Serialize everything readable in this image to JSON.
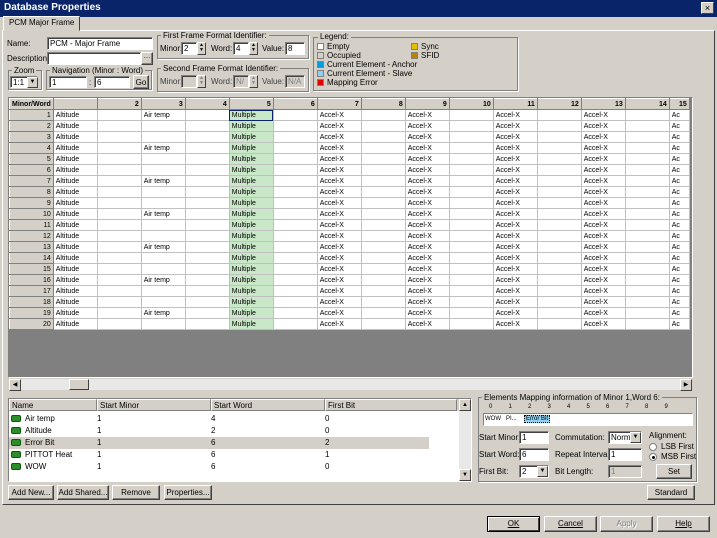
{
  "window": {
    "title": "Database Properties",
    "close_glyph": "×"
  },
  "tab": {
    "label": "PCM Major Frame"
  },
  "fields": {
    "name_label": "Name:",
    "name_value": "PCM - Major Frame",
    "description_label": "Description",
    "description_value": "",
    "zoom_label": "Zoom",
    "zoom_value": "1:1",
    "nav_label": "Navigation (Minor : Word)",
    "nav_minor": "1",
    "nav_sep": ":",
    "nav_word": "6",
    "go_label": "Go"
  },
  "first_ffi": {
    "title": "First Frame Format Identifier:",
    "minor_label": "Minor:",
    "minor_value": "2",
    "word_label": "Word:",
    "word_value": "4",
    "value_label": "Value:",
    "value_value": "8"
  },
  "second_ffi": {
    "title": "Second Frame Format Identifier:",
    "minor_label": "Minor:",
    "minor_value": "",
    "word_label": "Word:",
    "word_value": "N/",
    "value_label": "Value:",
    "value_value": "N/A"
  },
  "legend": {
    "title": "Legend:",
    "items": [
      {
        "label": "Empty",
        "color": "#ffffff"
      },
      {
        "label": "Occupied",
        "color": "#d4d0c8"
      },
      {
        "label": "Current Element - Anchor",
        "color": "#00a0e0"
      },
      {
        "label": "Current Element - Slave",
        "color": "#90d0f0"
      },
      {
        "label": "Mapping Error",
        "color": "#e00000"
      },
      {
        "label": "Sync",
        "color": "#e0c000"
      },
      {
        "label": "SFID",
        "color": "#c08000"
      }
    ]
  },
  "grid": {
    "corner": "Minor/Word",
    "columns": [
      "2",
      "3",
      "4",
      "5",
      "6",
      "7",
      "8",
      "9",
      "10",
      "11",
      "12",
      "13",
      "14",
      "15"
    ],
    "rows": [
      {
        "n": "1",
        "c": [
          "Altitude",
          "",
          "Air temp",
          "",
          "Multiple",
          "",
          "Accel-X",
          "",
          "Accel-X",
          "",
          "Accel-X",
          "",
          "Accel-X",
          "",
          "Ac"
        ]
      },
      {
        "n": "2",
        "c": [
          "Altitude",
          "",
          "",
          "",
          "Multiple",
          "",
          "Accel-X",
          "",
          "Accel-X",
          "",
          "Accel-X",
          "",
          "Accel-X",
          "",
          "Ac"
        ]
      },
      {
        "n": "3",
        "c": [
          "Altitude",
          "",
          "",
          "",
          "Multiple",
          "",
          "Accel-X",
          "",
          "Accel-X",
          "",
          "Accel-X",
          "",
          "Accel-X",
          "",
          "Ac"
        ]
      },
      {
        "n": "4",
        "c": [
          "Altitude",
          "",
          "Air temp",
          "",
          "Multiple",
          "",
          "Accel-X",
          "",
          "Accel-X",
          "",
          "Accel-X",
          "",
          "Accel-X",
          "",
          "Ac"
        ]
      },
      {
        "n": "5",
        "c": [
          "Altitude",
          "",
          "",
          "",
          "Multiple",
          "",
          "Accel-X",
          "",
          "Accel-X",
          "",
          "Accel-X",
          "",
          "Accel-X",
          "",
          "Ac"
        ]
      },
      {
        "n": "6",
        "c": [
          "Altitude",
          "",
          "",
          "",
          "Multiple",
          "",
          "Accel-X",
          "",
          "Accel-X",
          "",
          "Accel-X",
          "",
          "Accel-X",
          "",
          "Ac"
        ]
      },
      {
        "n": "7",
        "c": [
          "Altitude",
          "",
          "Air temp",
          "",
          "Multiple",
          "",
          "Accel-X",
          "",
          "Accel-X",
          "",
          "Accel-X",
          "",
          "Accel-X",
          "",
          "Ac"
        ]
      },
      {
        "n": "8",
        "c": [
          "Altitude",
          "",
          "",
          "",
          "Multiple",
          "",
          "Accel-X",
          "",
          "Accel-X",
          "",
          "Accel-X",
          "",
          "Accel-X",
          "",
          "Ac"
        ]
      },
      {
        "n": "9",
        "c": [
          "Altitude",
          "",
          "",
          "",
          "Multiple",
          "",
          "Accel-X",
          "",
          "Accel-X",
          "",
          "Accel-X",
          "",
          "Accel-X",
          "",
          "Ac"
        ]
      },
      {
        "n": "10",
        "c": [
          "Altitude",
          "",
          "Air temp",
          "",
          "Multiple",
          "",
          "Accel-X",
          "",
          "Accel-X",
          "",
          "Accel-X",
          "",
          "Accel-X",
          "",
          "Ac"
        ]
      },
      {
        "n": "11",
        "c": [
          "Altitude",
          "",
          "",
          "",
          "Multiple",
          "",
          "Accel-X",
          "",
          "Accel-X",
          "",
          "Accel-X",
          "",
          "Accel-X",
          "",
          "Ac"
        ]
      },
      {
        "n": "12",
        "c": [
          "Altitude",
          "",
          "",
          "",
          "Multiple",
          "",
          "Accel-X",
          "",
          "Accel-X",
          "",
          "Accel-X",
          "",
          "Accel-X",
          "",
          "Ac"
        ]
      },
      {
        "n": "13",
        "c": [
          "Altitude",
          "",
          "Air temp",
          "",
          "Multiple",
          "",
          "Accel-X",
          "",
          "Accel-X",
          "",
          "Accel-X",
          "",
          "Accel-X",
          "",
          "Ac"
        ]
      },
      {
        "n": "14",
        "c": [
          "Altitude",
          "",
          "",
          "",
          "Multiple",
          "",
          "Accel-X",
          "",
          "Accel-X",
          "",
          "Accel-X",
          "",
          "Accel-X",
          "",
          "Ac"
        ]
      },
      {
        "n": "15",
        "c": [
          "Altitude",
          "",
          "",
          "",
          "Multiple",
          "",
          "Accel-X",
          "",
          "Accel-X",
          "",
          "Accel-X",
          "",
          "Accel-X",
          "",
          "Ac"
        ]
      },
      {
        "n": "16",
        "c": [
          "Altitude",
          "",
          "Air temp",
          "",
          "Multiple",
          "",
          "Accel-X",
          "",
          "Accel-X",
          "",
          "Accel-X",
          "",
          "Accel-X",
          "",
          "Ac"
        ]
      },
      {
        "n": "17",
        "c": [
          "Altitude",
          "",
          "",
          "",
          "Multiple",
          "",
          "Accel-X",
          "",
          "Accel-X",
          "",
          "Accel-X",
          "",
          "Accel-X",
          "",
          "Ac"
        ]
      },
      {
        "n": "18",
        "c": [
          "Altitude",
          "",
          "",
          "",
          "Multiple",
          "",
          "Accel-X",
          "",
          "Accel-X",
          "",
          "Accel-X",
          "",
          "Accel-X",
          "",
          "Ac"
        ]
      },
      {
        "n": "19",
        "c": [
          "Altitude",
          "",
          "Air temp",
          "",
          "Multiple",
          "",
          "Accel-X",
          "",
          "Accel-X",
          "",
          "Accel-X",
          "",
          "Accel-X",
          "",
          "Ac"
        ]
      },
      {
        "n": "20",
        "c": [
          "Altitude",
          "",
          "",
          "",
          "Multiple",
          "",
          "Accel-X",
          "",
          "Accel-X",
          "",
          "Accel-X",
          "",
          "Accel-X",
          "",
          "Ac"
        ]
      }
    ]
  },
  "elements": {
    "headers": [
      "Name",
      "Start Minor",
      "Start Word",
      "First Bit"
    ],
    "rows": [
      {
        "name": "Air temp",
        "minor": "1",
        "word": "4",
        "bit": "0",
        "selected": false
      },
      {
        "name": "Altitude",
        "minor": "1",
        "word": "2",
        "bit": "0",
        "selected": false
      },
      {
        "name": "Error Bit",
        "minor": "1",
        "word": "6",
        "bit": "2",
        "selected": true
      },
      {
        "name": "PITTOT Heat",
        "minor": "1",
        "word": "6",
        "bit": "1",
        "selected": false
      },
      {
        "name": "WOW",
        "minor": "1",
        "word": "6",
        "bit": "0",
        "selected": false
      }
    ]
  },
  "list_buttons": {
    "add_new": "Add New...",
    "add_shared": "Add Shared...",
    "remove": "Remove",
    "properties": "Properties..."
  },
  "mapping": {
    "title": "Elements Mapping information of Minor 1,Word 6:",
    "ruler_ticks": [
      "0",
      "1",
      "2",
      "3",
      "4",
      "5",
      "6",
      "7",
      "8",
      "9"
    ],
    "ruler_items": [
      "WOW",
      "PI...",
      "Error Bit"
    ],
    "start_minor_label": "Start Minor:",
    "start_minor": "1",
    "start_word_label": "Start Word:",
    "start_word": "6",
    "first_bit_label": "First Bit:",
    "first_bit": "2",
    "commutation_label": "Commutation:",
    "commutation": "Norm",
    "repeat_label": "Repeat Interval:",
    "repeat": "1",
    "bitlen_label": "Bit Length:",
    "bitlen": "1",
    "alignment_label": "Alignment:",
    "lsb": "LSB First",
    "msb": "MSB First",
    "set_label": "Set",
    "standard_label": "Standard"
  },
  "dialog_buttons": {
    "ok": "OK",
    "cancel": "Cancel",
    "apply": "Apply",
    "help": "Help"
  }
}
